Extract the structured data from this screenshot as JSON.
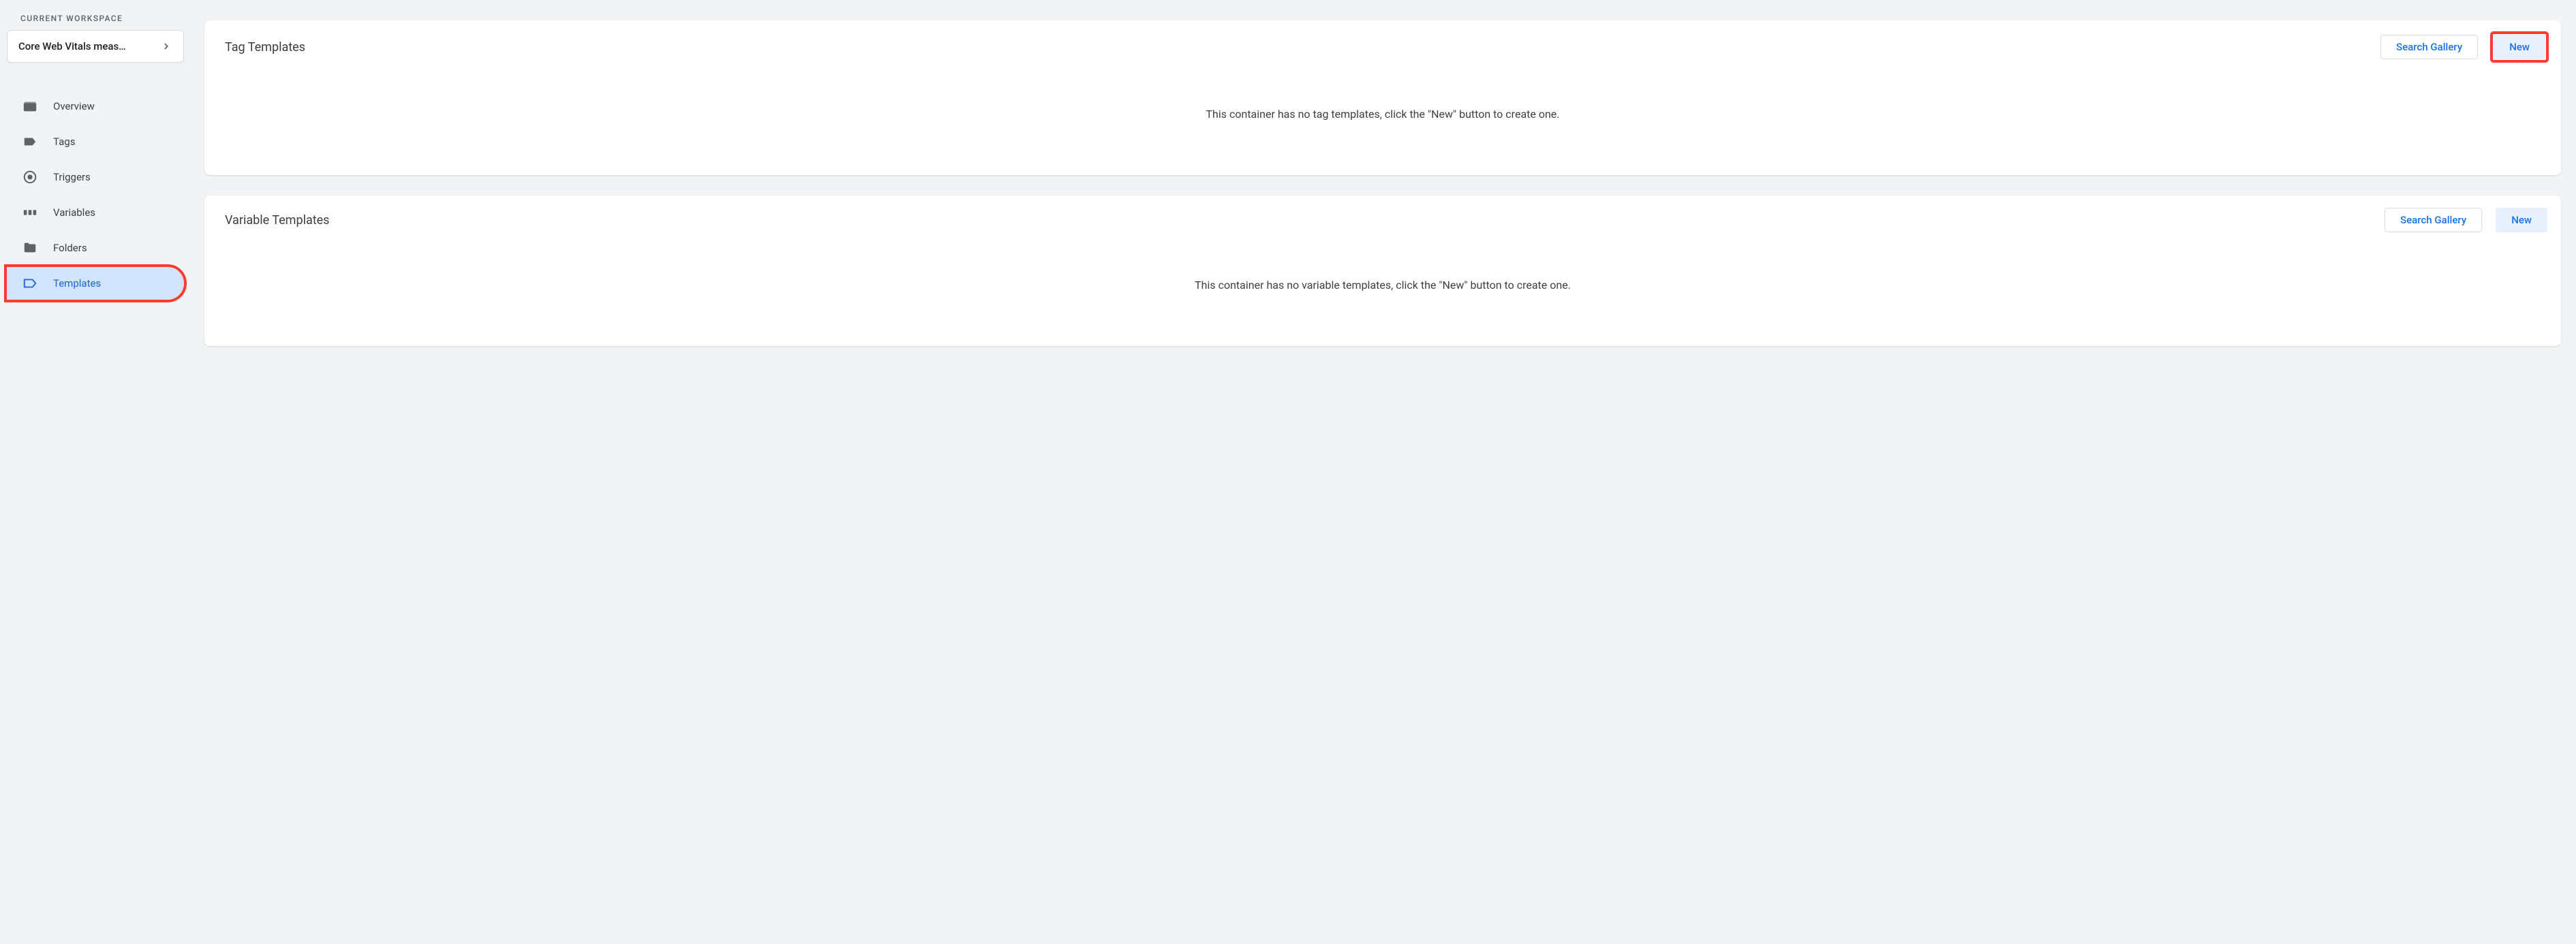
{
  "sidebar": {
    "workspace_heading": "CURRENT WORKSPACE",
    "workspace_name": "Core Web Vitals meas…",
    "items": [
      {
        "icon": "overview-icon",
        "label": "Overview",
        "active": false
      },
      {
        "icon": "tags-icon",
        "label": "Tags",
        "active": false
      },
      {
        "icon": "triggers-icon",
        "label": "Triggers",
        "active": false
      },
      {
        "icon": "variables-icon",
        "label": "Variables",
        "active": false
      },
      {
        "icon": "folders-icon",
        "label": "Folders",
        "active": false
      },
      {
        "icon": "templates-icon",
        "label": "Templates",
        "active": true
      }
    ]
  },
  "panels": {
    "tag": {
      "title": "Tag Templates",
      "search_label": "Search Gallery",
      "new_label": "New",
      "empty_message": "This container has no tag templates, click the \"New\" button to create one."
    },
    "variable": {
      "title": "Variable Templates",
      "search_label": "Search Gallery",
      "new_label": "New",
      "empty_message": "This container has no variable templates, click the \"New\" button to create one."
    }
  }
}
